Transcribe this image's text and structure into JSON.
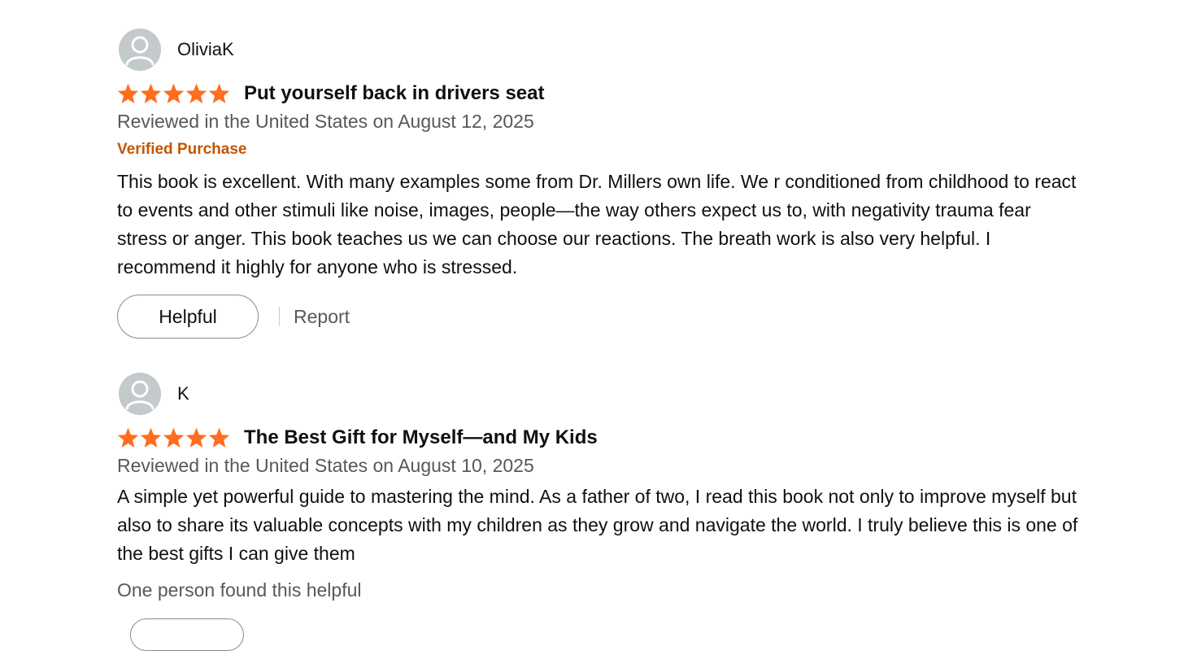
{
  "reviews": [
    {
      "profile_name": "OliviaK",
      "rating": 5,
      "title": "Put yourself back in drivers seat",
      "date_line": "Reviewed in the United States on August 12, 2025",
      "verified_label": "Verified Purchase",
      "body": "This book is excellent. With many examples some from Dr. Millers own life. We r conditioned from childhood to react to events and other stimuli like noise, images, people—the way others expect us to, with negativity trauma fear stress or anger. This book teaches us we can choose our reactions. The breath work is also very helpful. I recommend it highly for anyone who is stressed.",
      "helpful_label": "Helpful",
      "report_label": "Report"
    },
    {
      "profile_name": "K",
      "rating": 5,
      "title": "The Best Gift for Myself—and My Kids",
      "date_line": "Reviewed in the United States on August 10, 2025",
      "body": "A simple yet powerful guide to mastering the mind. As a father of two, I read this book not only to improve myself but also to share its valuable concepts with my children as they grow and navigate the world. I truly believe this is one of the best gifts I can give them",
      "helpful_count_text": "One person found this helpful"
    }
  ],
  "colors": {
    "star": "#ff6d1f",
    "verified": "#c45500",
    "secondary_text": "#565959",
    "avatar_bg": "#c4c9cc"
  },
  "icons": {
    "avatar": "user-silhouette-icon",
    "star": "star-filled-icon"
  }
}
